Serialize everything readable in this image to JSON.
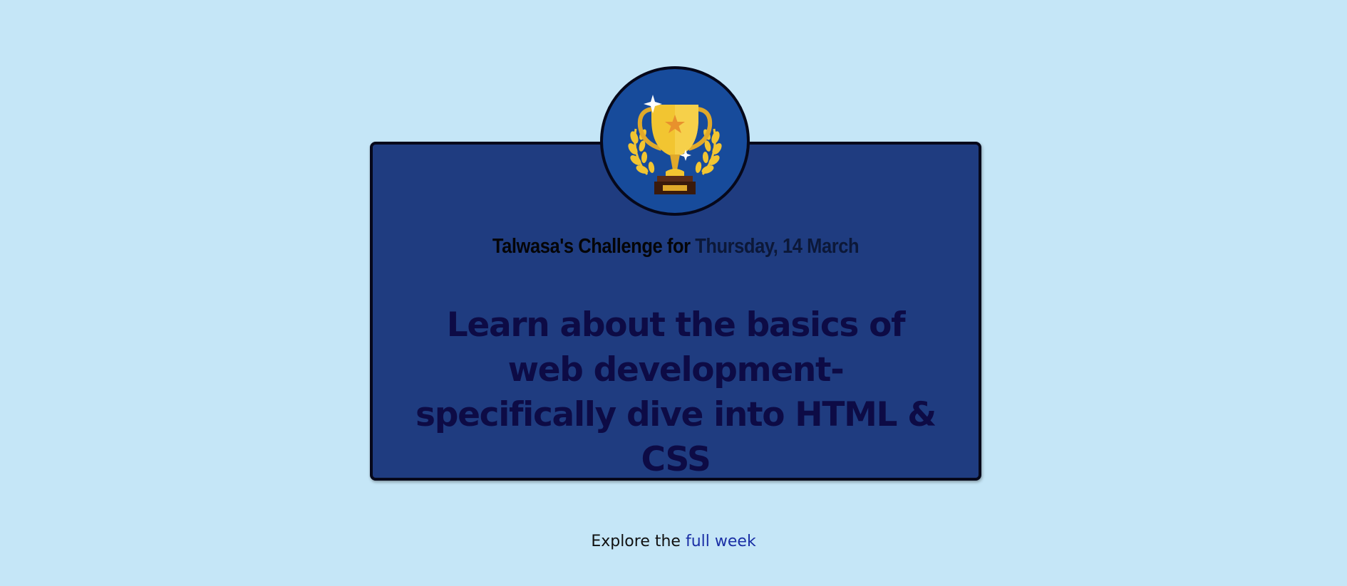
{
  "header": {
    "prefix": "Talwasa's Challenge for ",
    "date": "Thursday, 14 March"
  },
  "challenge": {
    "text": "Learn about the basics of web development-specifically dive into HTML & CSS"
  },
  "badge": {
    "icon": "trophy-icon"
  },
  "footer": {
    "prefix": "Explore the ",
    "link_text": "full week"
  },
  "colors": {
    "background": "#c5e6f7",
    "card": "#1f3c80",
    "badge": "#174b9b",
    "border": "#06081a",
    "challenge_text": "#0d0b45",
    "link": "#1a2fa5",
    "trophy_gold": "#f2c531"
  }
}
